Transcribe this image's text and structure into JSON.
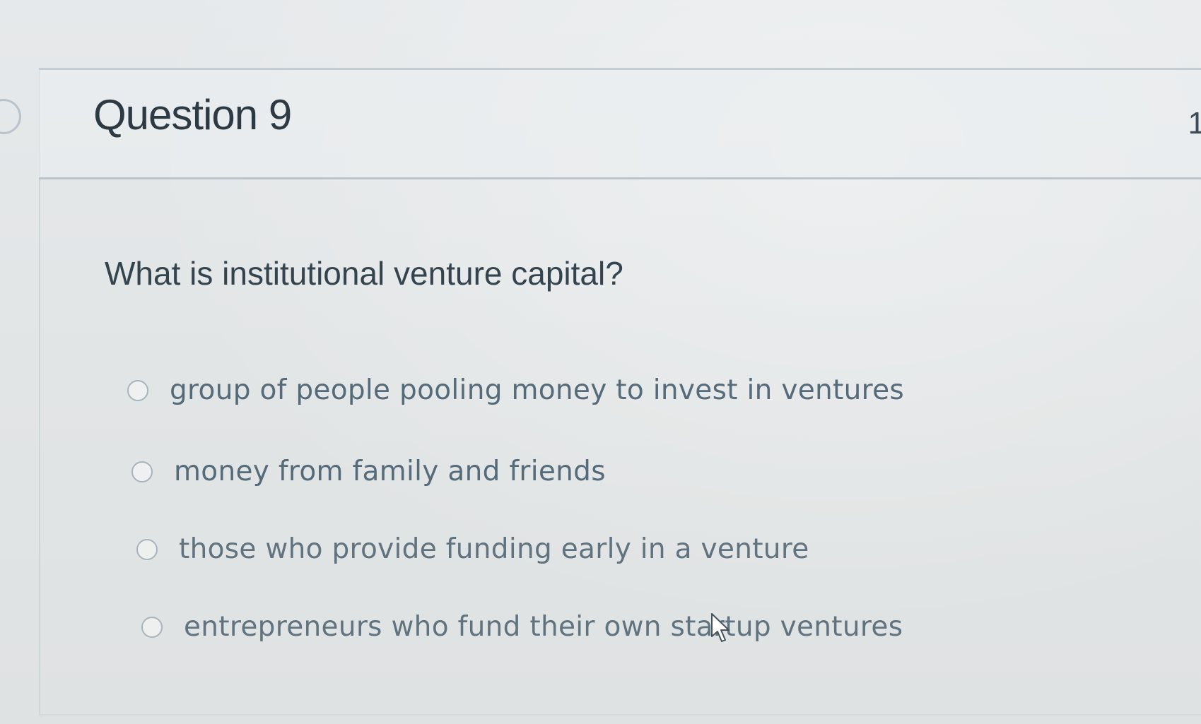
{
  "question": {
    "title": "Question 9",
    "points_fragment": "1",
    "prompt": "What is institutional venture capital?",
    "options": [
      {
        "label": "group of people pooling money to invest in ventures",
        "selected": false
      },
      {
        "label": "money from family and friends",
        "selected": false
      },
      {
        "label": "those who provide funding early in a venture",
        "selected": false
      },
      {
        "label": "entrepreneurs who fund their own startup ventures",
        "selected": false
      }
    ]
  },
  "icons": {
    "nav": "chevron-left-icon",
    "cursor": "mouse-pointer-icon"
  },
  "colors": {
    "background": "#e3e6e8",
    "title_text": "#2d3a44",
    "option_text": "#566b79",
    "radio_border": "#a7b4bd",
    "header_rule": "#b9c4cb"
  }
}
